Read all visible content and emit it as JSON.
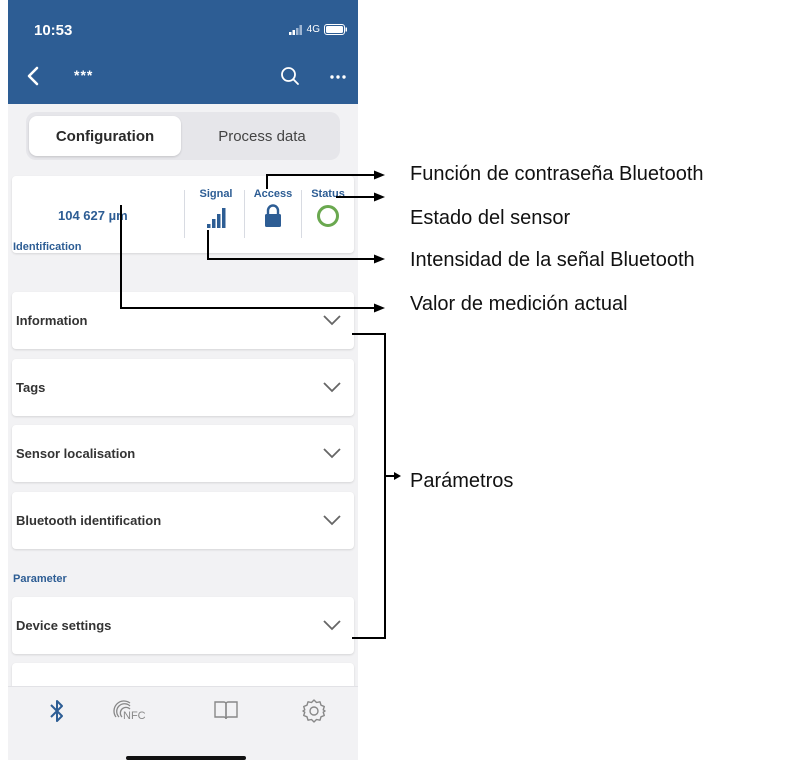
{
  "status_bar": {
    "time": "10:53",
    "network": "4G"
  },
  "app_bar": {
    "title": "***",
    "back_icon": "chevron-left-icon",
    "search_icon": "search-icon",
    "more_icon": "more-horizontal-icon"
  },
  "tabs": {
    "configuration": "Configuration",
    "process_data": "Process data",
    "selected": "Configuration"
  },
  "summary": {
    "measurement_value": "104 627 µm",
    "signal_label": "Signal",
    "access_label": "Access",
    "status_label": "Status",
    "status_color": "#6aa84f",
    "accent_color": "#2d5d94"
  },
  "sections": {
    "identification": {
      "label": "Identification",
      "items": [
        "Information",
        "Tags",
        "Sensor localisation",
        "Bluetooth identification"
      ]
    },
    "parameter": {
      "label": "Parameter",
      "items": [
        "Device settings"
      ]
    }
  },
  "tab_bar": {
    "items": [
      "bluetooth-icon",
      "nfc-icon",
      "book-icon",
      "settings-icon"
    ],
    "nfc_text": "NFC"
  },
  "annotations": {
    "password_function": "Función de contraseña Bluetooth",
    "sensor_status": "Estado del sensor",
    "signal_strength": "Intensidad de la señal Bluetooth",
    "current_value": "Valor de medición actual",
    "parameters": "Parámetros"
  }
}
